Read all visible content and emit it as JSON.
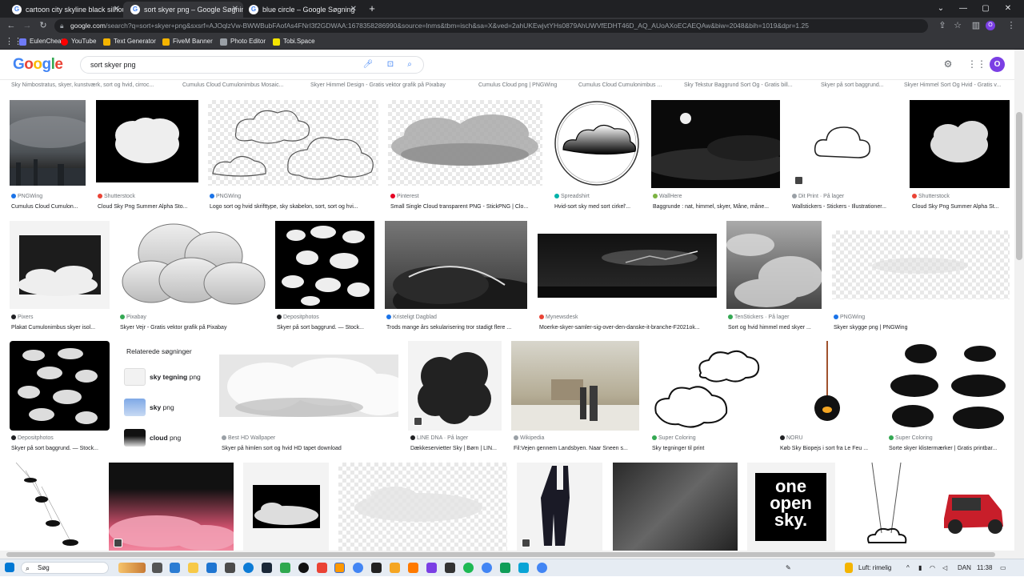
{
  "browser": {
    "tabs": [
      {
        "title": "cartoon city skyline black silhou",
        "active": false
      },
      {
        "title": "sort skyer png – Google Søgning",
        "active": true
      },
      {
        "title": "blue circle – Google Søgning",
        "active": false
      }
    ],
    "new_tab_label": "+",
    "url_host": "google.com",
    "url_rest": "/search?q=sort+skyer+png&sxsrf=AJOqlzVw-BWWBubFAofAs4FNrI3f2GDWAA:1678358286990&source=lnms&tbm=isch&sa=X&ved=2ahUKEwjvtYHs0879AhUWVfEDHT46D_AQ_AUoAXoECAEQAw&biw=2048&bih=1019&dpr=1.25",
    "bookmarks": [
      {
        "label": "EulenCheats",
        "color": "#6f7bf7"
      },
      {
        "label": "YouTube",
        "color": "#ff0000"
      },
      {
        "label": "Text Generator",
        "color": "#f4b400"
      },
      {
        "label": "FiveM Banner",
        "color": "#f4b400"
      },
      {
        "label": "Photo Editor",
        "color": "#9aa0a6"
      },
      {
        "label": "Tobi.Space",
        "color": "#f4e400"
      }
    ]
  },
  "google": {
    "logo": [
      "G",
      "o",
      "o",
      "g",
      "l",
      "e"
    ],
    "logo_colors": [
      "#4285f4",
      "#ea4335",
      "#fbbc05",
      "#4285f4",
      "#34a853",
      "#ea4335"
    ],
    "query": "sort skyer png",
    "avatar_letter": "O"
  },
  "top_captions": [
    "Sky Nimbostratus, skyer, kunstværk, sort og hvid, cirroc...",
    "Cumulus Cloud Cumulonimbus Mosaic...",
    "Skyer Himmel Design - Gratis vektor grafik på Pixabay",
    "Cumulus Cloud png | PNGWing",
    "Cumulus Cloud Cumulonimbus ...",
    "Sky Tekstur Baggrund Sort Og - Gratis bill...",
    "Skyer på sort baggrund...",
    "Skyer Himmel Sort Og Hvid - Gratis v..."
  ],
  "row1": [
    {
      "source": "PNGWing",
      "dot": "#1a73e8",
      "title": "Cumulus Cloud Cumulon..."
    },
    {
      "source": "Shutterstock",
      "dot": "#ea4335",
      "title": "Cloud Sky Png Summer Alpha Sto..."
    },
    {
      "source": "PNGWing",
      "dot": "#1a73e8",
      "title": "Logo sort og hvid skrifttype, sky skabelon, sort, sort og hvi..."
    },
    {
      "source": "Pinterest",
      "dot": "#e60023",
      "title": "Small Single Cloud transparent PNG - StickPNG | Clo..."
    },
    {
      "source": "Spreadshirt",
      "dot": "#00b2a9",
      "title": "Hvid-sort sky med sort cirkel'..."
    },
    {
      "source": "WallHere",
      "dot": "#7cb342",
      "title": "Baggrunde : nat, himmel, skyer, Måne, måne..."
    },
    {
      "source": "Dit Print · På lager",
      "dot": "#9aa0a6",
      "title": "Wallstickers - Stickers - Illustrationer..."
    },
    {
      "source": "Shutterstock",
      "dot": "#ea4335",
      "title": "Cloud Sky Png Summer Alpha St..."
    }
  ],
  "row2": [
    {
      "source": "Pixers",
      "dot": "#202124",
      "title": "Plakat Cumulonimbus skyer isol..."
    },
    {
      "source": "Pixabay",
      "dot": "#34a853",
      "title": "Skyer Vejr - Gratis vektor grafik på Pixabay"
    },
    {
      "source": "Depositphotos",
      "dot": "#202124",
      "title": "Skyer på sort baggrund. — Stock..."
    },
    {
      "source": "Kristeligt Dagblad",
      "dot": "#1a73e8",
      "title": "Trods mange års sekularisering tror stadigt flere ..."
    },
    {
      "source": "Mynewsdesk",
      "dot": "#ea4335",
      "title": "Moerke-skyer-samler-sig-over-den-danske-it-branche-F2021ok..."
    },
    {
      "source": "TenStickers · På lager",
      "dot": "#34a853",
      "title": "Sort og hvid himmel med skyer ..."
    },
    {
      "source": "PNGWing",
      "dot": "#1a73e8",
      "title": "Skyer skygge png | PNGWing"
    }
  ],
  "related": {
    "heading": "Relaterede søgninger",
    "items": [
      {
        "bold": "sky tegning",
        "rest": " png"
      },
      {
        "bold": "sky",
        "rest": " png"
      },
      {
        "bold": "cloud",
        "rest": " png"
      }
    ]
  },
  "row3": [
    {
      "source": "Depositphotos",
      "dot": "#202124",
      "title": "Skyer på sort baggrund. — Stock..."
    },
    {
      "source": "Best HD Wallpaper",
      "dot": "#9aa0a6",
      "title": "Skyer på himlen sort og hvid HD tapet download"
    },
    {
      "source": "LINE DNA · På lager",
      "dot": "#202124",
      "title": "Dækkeservietter Sky | Børn | LIN..."
    },
    {
      "source": "Wikipedia",
      "dot": "#9aa0a6",
      "title": "Fil:Vejen gennem Landsbyen. Naar Sneen s..."
    },
    {
      "source": "Super Coloring",
      "dot": "#34a853",
      "title": "Sky tegninger til print"
    },
    {
      "source": "NORU",
      "dot": "#202124",
      "title": "Køb Sky Biopejs i sort fra Le Feu ..."
    },
    {
      "source": "Super Coloring",
      "dot": "#34a853",
      "title": "Sorte skyer klistermærker | Gratis printbar..."
    }
  ],
  "row4_text": {
    "line1": "one",
    "line2": "open",
    "line3": "sky."
  },
  "taskbar": {
    "search_label": "Søg",
    "weather": "Luft: rimelig",
    "lang": "DAN",
    "time": "11:38"
  }
}
